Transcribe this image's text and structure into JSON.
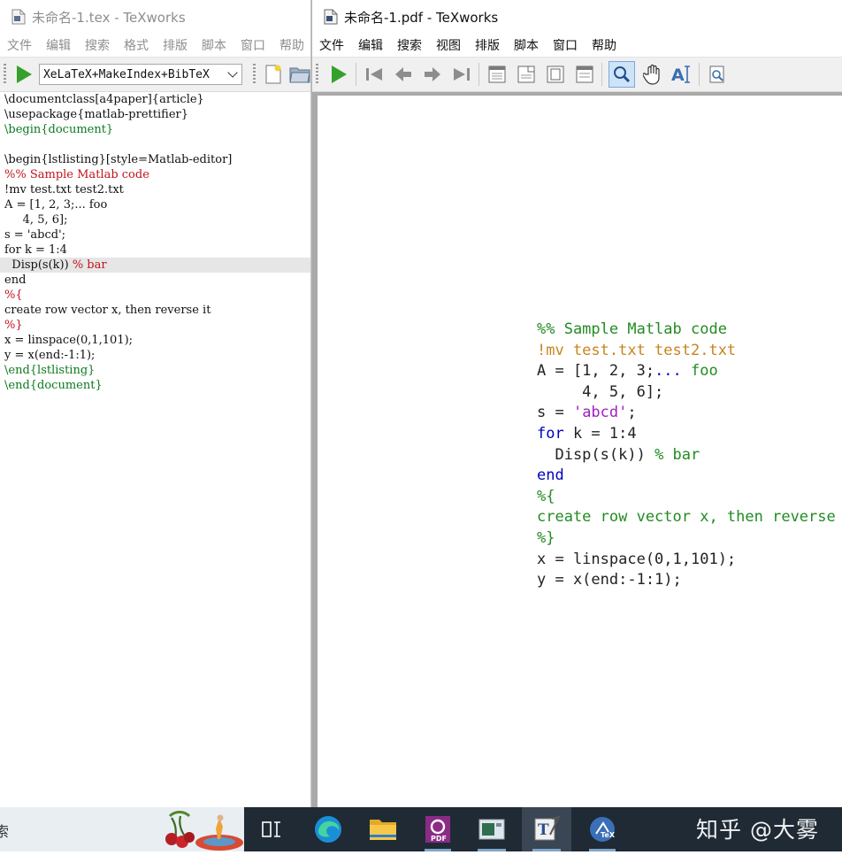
{
  "left_window": {
    "title": "未命名-1.tex - TeXworks",
    "menu": [
      "文件",
      "编辑",
      "搜索",
      "格式",
      "排版",
      "脚本",
      "窗口",
      "帮助"
    ],
    "engine": "XeLaTeX+MakeIndex+BibTeX",
    "editor_lines": [
      {
        "parts": [
          {
            "t": "\\documentclass[a4paper]{article}",
            "c": ""
          }
        ]
      },
      {
        "parts": [
          {
            "t": "\\usepackage{matlab-prettifier}",
            "c": ""
          }
        ]
      },
      {
        "parts": [
          {
            "t": "\\begin{document}",
            "c": "green"
          }
        ]
      },
      {
        "parts": [
          {
            "t": "",
            "c": ""
          }
        ]
      },
      {
        "parts": [
          {
            "t": "\\begin{lstlisting}[style=Matlab-editor]",
            "c": ""
          }
        ]
      },
      {
        "parts": [
          {
            "t": "%% Sample Matlab code",
            "c": "red"
          }
        ]
      },
      {
        "parts": [
          {
            "t": "!mv test.txt test2.txt",
            "c": ""
          }
        ]
      },
      {
        "parts": [
          {
            "t": "A = [1, 2, 3;... foo",
            "c": ""
          }
        ]
      },
      {
        "parts": [
          {
            "t": "     4, 5, 6];",
            "c": ""
          }
        ]
      },
      {
        "parts": [
          {
            "t": "s = 'abcd';",
            "c": ""
          }
        ]
      },
      {
        "parts": [
          {
            "t": "for k = 1:4",
            "c": ""
          }
        ]
      },
      {
        "parts": [
          {
            "t": "  Disp(s(k)) ",
            "c": ""
          },
          {
            "t": "% bar",
            "c": "red"
          }
        ],
        "highlight": true
      },
      {
        "parts": [
          {
            "t": "end",
            "c": ""
          }
        ]
      },
      {
        "parts": [
          {
            "t": "%{",
            "c": "red"
          }
        ]
      },
      {
        "parts": [
          {
            "t": "create row vector x, then reverse it",
            "c": ""
          }
        ]
      },
      {
        "parts": [
          {
            "t": "%}",
            "c": "red"
          }
        ]
      },
      {
        "parts": [
          {
            "t": "x = linspace(0,1,101);",
            "c": ""
          }
        ]
      },
      {
        "parts": [
          {
            "t": "y = x(end:-1:1);",
            "c": ""
          }
        ]
      },
      {
        "parts": [
          {
            "t": "\\end{lstlisting}",
            "c": "green"
          }
        ]
      },
      {
        "parts": [
          {
            "t": "\\end{document}",
            "c": "green"
          }
        ]
      }
    ]
  },
  "right_window": {
    "title": "未命名-1.pdf - TeXworks",
    "menu": [
      "文件",
      "编辑",
      "搜索",
      "视图",
      "排版",
      "脚本",
      "窗口",
      "帮助"
    ],
    "pdf_lines": [
      {
        "parts": [
          {
            "t": "%% Sample Matlab code",
            "c": "green"
          }
        ]
      },
      {
        "parts": [
          {
            "t": "!mv test.txt test2.txt",
            "c": "orange"
          }
        ]
      },
      {
        "parts": [
          {
            "t": "A = [1, 2, 3;",
            "c": ""
          },
          {
            "t": "...",
            "c": "blue"
          },
          {
            "t": " foo",
            "c": "green"
          }
        ]
      },
      {
        "parts": [
          {
            "t": "     4, 5, 6];",
            "c": ""
          }
        ]
      },
      {
        "parts": [
          {
            "t": "s = ",
            "c": ""
          },
          {
            "t": "'abcd'",
            "c": "purple"
          },
          {
            "t": ";",
            "c": ""
          }
        ]
      },
      {
        "parts": [
          {
            "t": "for",
            "c": "blue"
          },
          {
            "t": " k = 1:4",
            "c": ""
          }
        ]
      },
      {
        "parts": [
          {
            "t": "  Disp(s(k)) ",
            "c": ""
          },
          {
            "t": "% bar",
            "c": "green"
          }
        ]
      },
      {
        "parts": [
          {
            "t": "end",
            "c": "blue"
          }
        ]
      },
      {
        "parts": [
          {
            "t": "%{",
            "c": "green"
          }
        ]
      },
      {
        "parts": [
          {
            "t": "create row vector x, then reverse it",
            "c": "green"
          }
        ]
      },
      {
        "parts": [
          {
            "t": "%}",
            "c": "green"
          }
        ]
      },
      {
        "parts": [
          {
            "t": "x = linspace(0,1,101);",
            "c": ""
          }
        ]
      },
      {
        "parts": [
          {
            "t": "y = x(end:-1:1);",
            "c": ""
          }
        ]
      }
    ]
  },
  "taskbar": {
    "left_fragment": "索",
    "watermark": "知乎 @大雾"
  }
}
